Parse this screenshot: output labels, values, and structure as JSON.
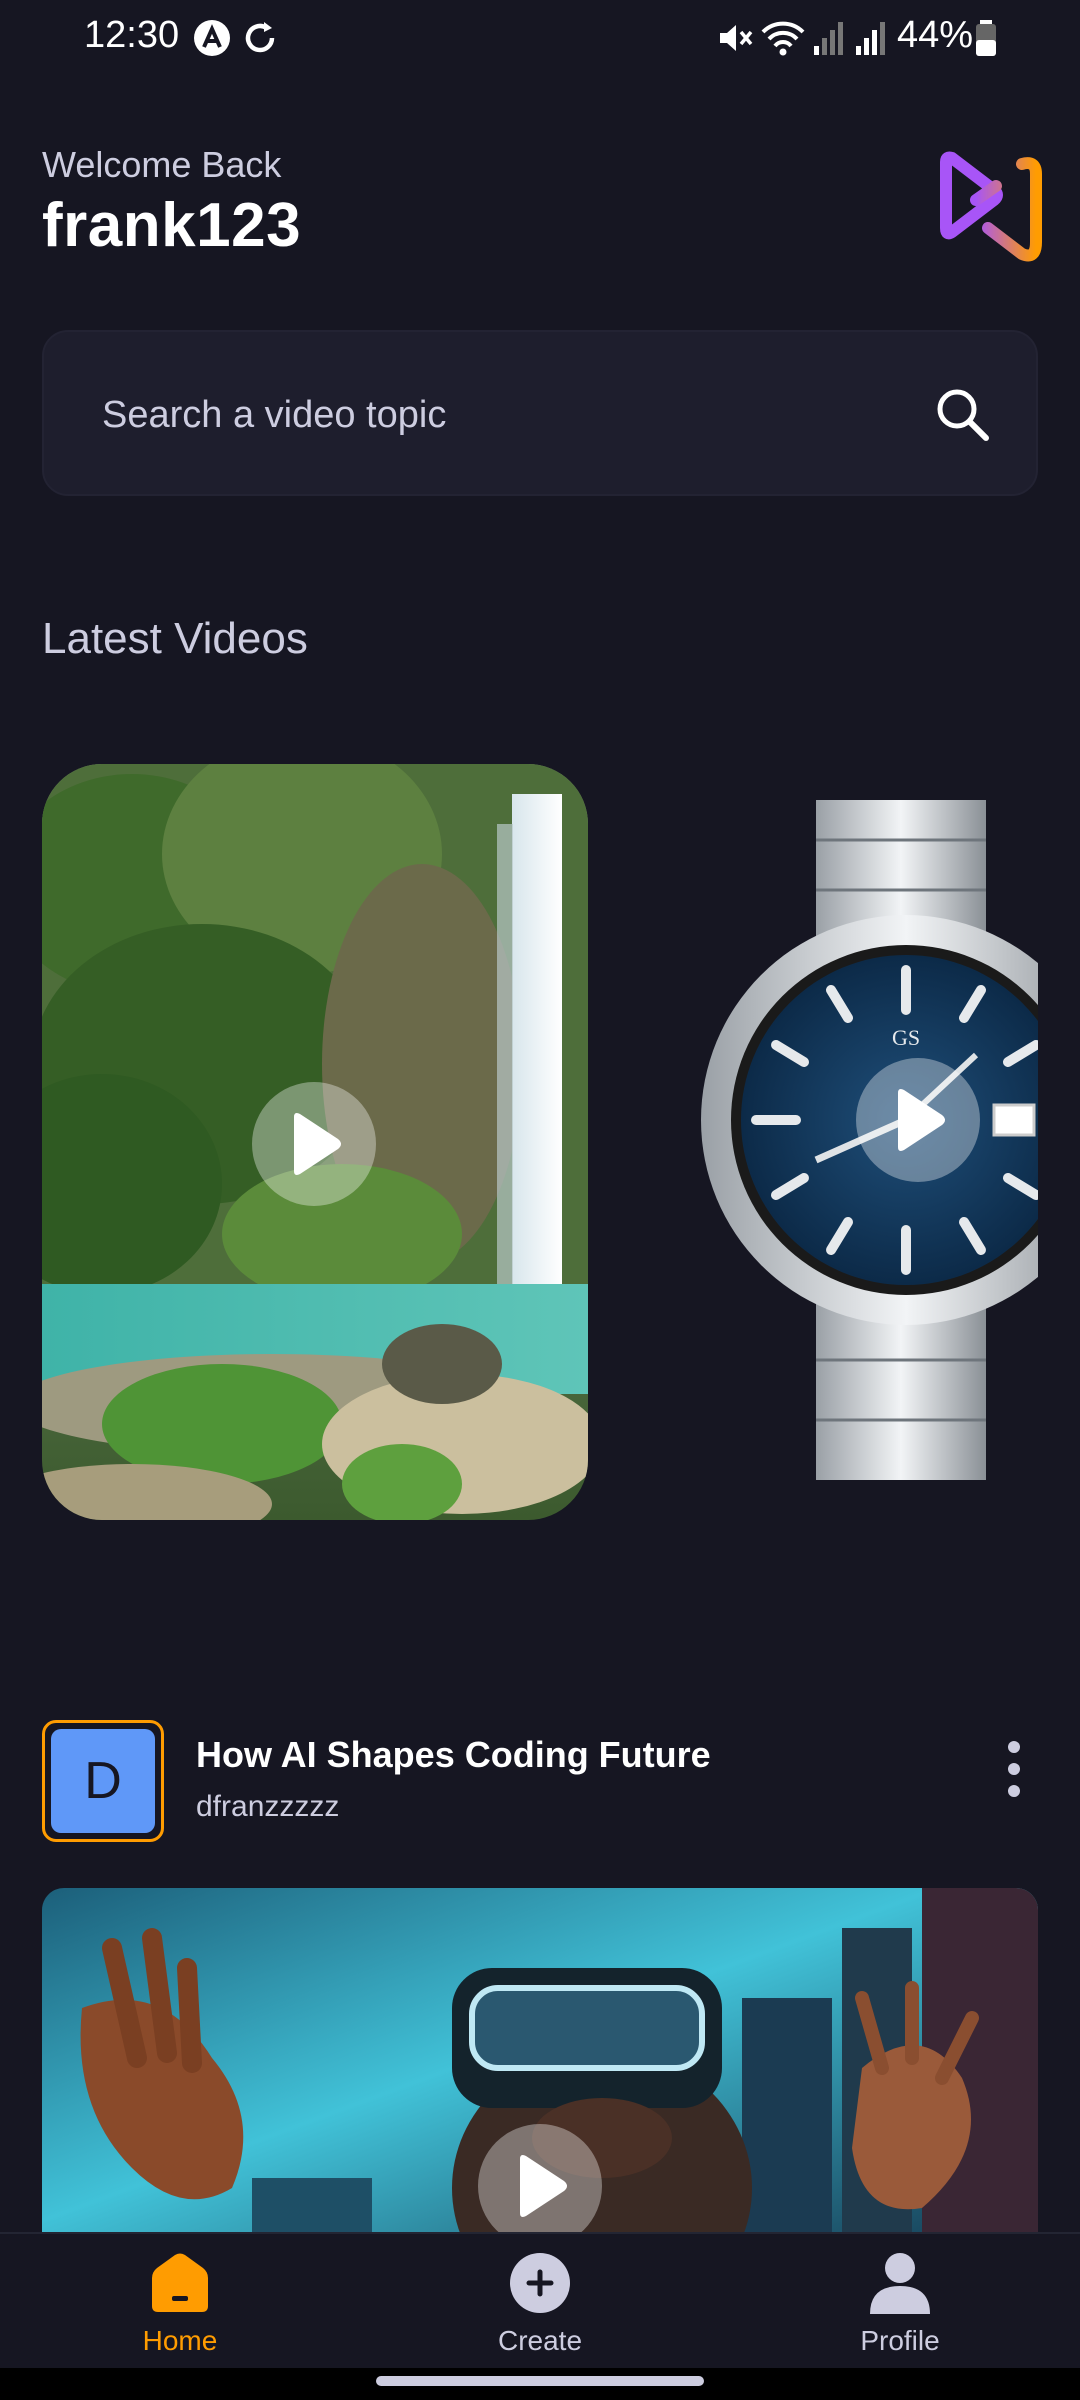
{
  "status_bar": {
    "time": "12:30",
    "battery": "44%"
  },
  "header": {
    "welcome": "Welcome Back",
    "username": "frank123"
  },
  "search": {
    "placeholder": "Search a video topic"
  },
  "latest": {
    "title": "Latest Videos"
  },
  "post": {
    "avatar_letter": "D",
    "title": "How AI Shapes Coding Future",
    "author": "dfranzzzzz"
  },
  "tabs": [
    {
      "label": "Home",
      "icon": "home-icon",
      "active": true
    },
    {
      "label": "Create",
      "icon": "plus-circle-icon",
      "active": false
    },
    {
      "label": "Profile",
      "icon": "profile-icon",
      "active": false
    }
  ],
  "colors": {
    "background": "#161622",
    "accent": "#ff9c01",
    "inactive": "#cdcde0",
    "card": "#1e1e2d"
  }
}
